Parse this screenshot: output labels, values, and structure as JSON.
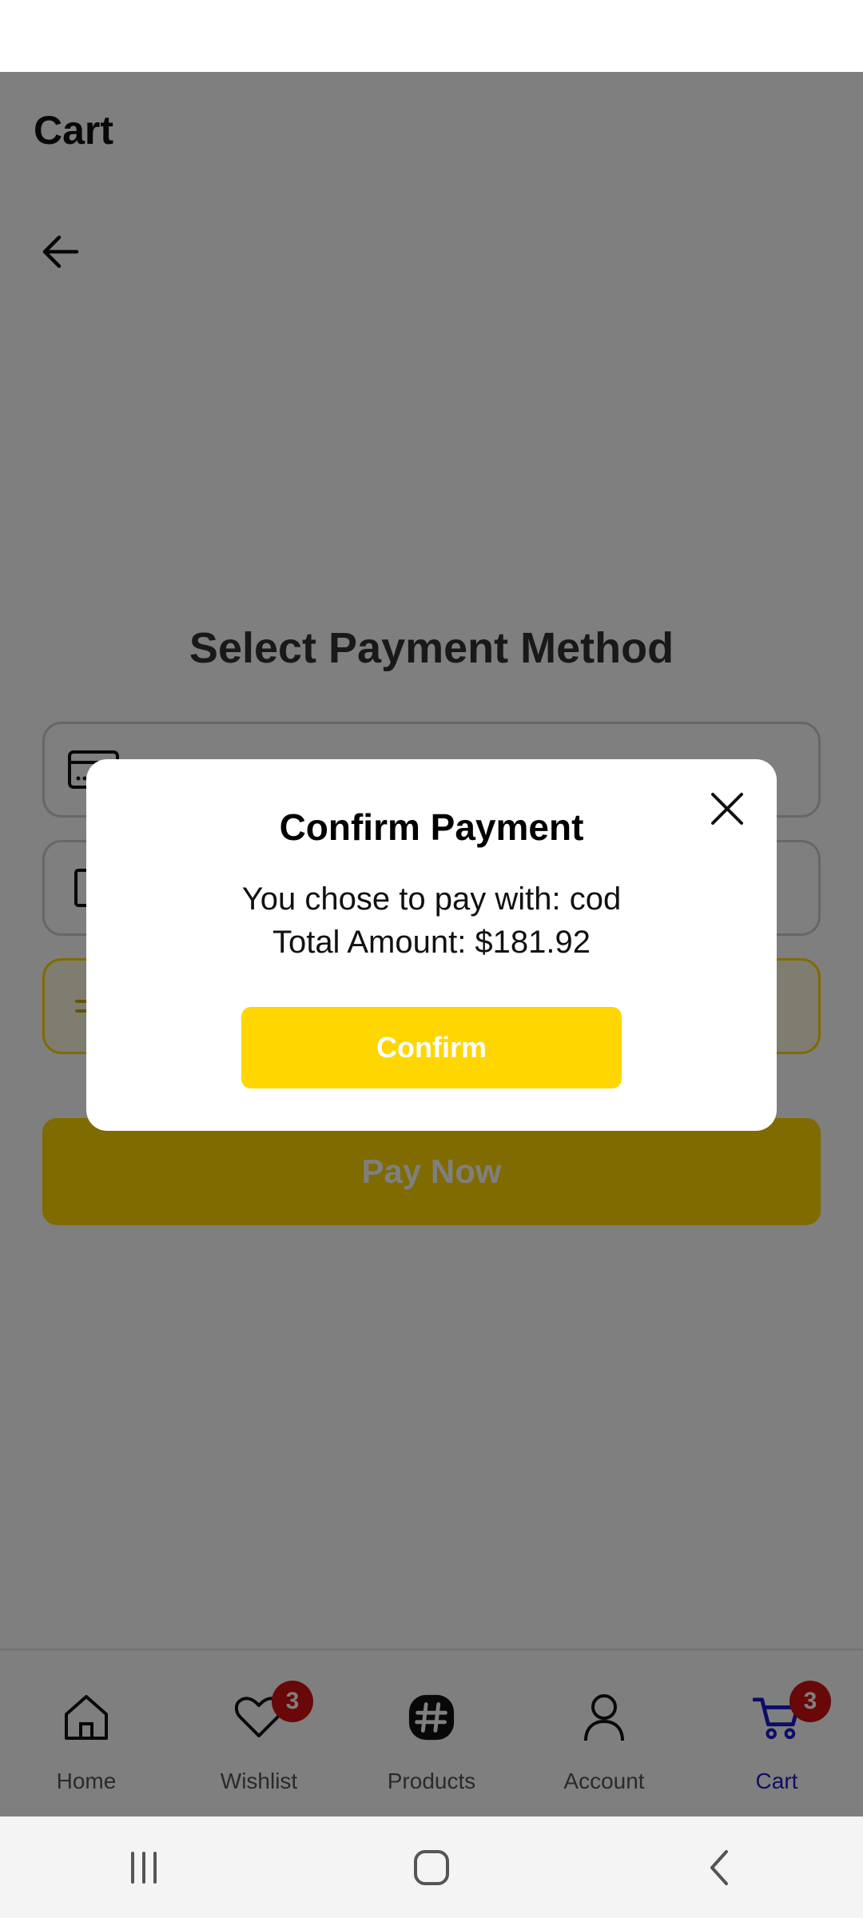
{
  "app": {
    "page_title": "Cart"
  },
  "payment": {
    "heading": "Select Payment Method",
    "options": [
      {
        "label": "",
        "icon": "credit-card-icon"
      },
      {
        "label": "",
        "icon": "checkbox-icon"
      },
      {
        "label": "",
        "icon": "cash-icon"
      }
    ],
    "pay_now_label": "Pay Now"
  },
  "modal": {
    "title": "Confirm Payment",
    "line1": "You chose to pay with: cod",
    "line2": "Total Amount: $181.92",
    "confirm_label": "Confirm"
  },
  "bottom_nav": {
    "items": [
      {
        "label": "Home",
        "icon": "home-icon"
      },
      {
        "label": "Wishlist",
        "icon": "heart-icon",
        "badge": "3"
      },
      {
        "label": "Products",
        "icon": "products-icon"
      },
      {
        "label": "Account",
        "icon": "account-icon"
      },
      {
        "label": "Cart",
        "icon": "cart-icon",
        "badge": "3",
        "active": true
      }
    ]
  },
  "colors": {
    "accent": "#ffd600",
    "active_nav": "#1a1acc",
    "badge": "#d01010"
  }
}
